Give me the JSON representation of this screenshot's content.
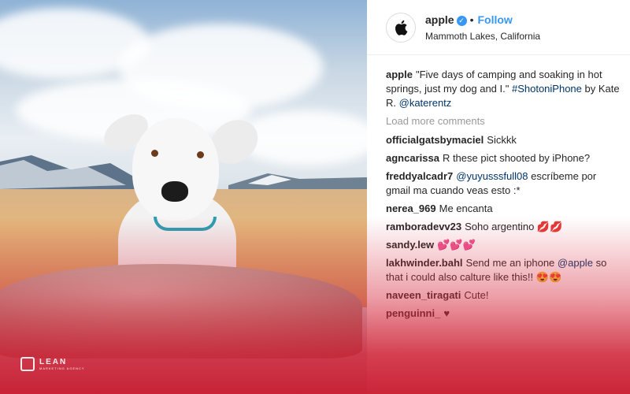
{
  "post": {
    "username": "apple",
    "dot": "•",
    "follow_label": "Follow",
    "location": "Mammoth Lakes, California",
    "caption_user": "apple",
    "caption_text": "\"Five days of camping and soaking in hot springs, just my dog and I.\"",
    "caption_hashtag": "#ShotoniPhone",
    "caption_by": "by Kate R.",
    "caption_mention": "@katerentz",
    "load_more": "Load more comments"
  },
  "comments": [
    {
      "user": "officialgatsbymaciel",
      "text": "Sickkk"
    },
    {
      "user": "agncarissa",
      "text": "R these pict shooted by iPhone?"
    },
    {
      "user": "freddyalcadr7",
      "mention": "@yuyusssfull08",
      "text": "escríbeme por gmail ma cuando veas esto :*"
    },
    {
      "user": "nerea_969",
      "text": "Me encanta"
    },
    {
      "user": "ramboradevv23",
      "text": "Soho argentino 💋💋"
    },
    {
      "user": "sandy.lew",
      "text": "💕💕💕"
    },
    {
      "user": "lakhwinder.bahl",
      "text": "Send me an iphone",
      "mention": "@apple",
      "text2": "so that i could also calture like this!! 😍😍"
    },
    {
      "user": "naveen_tiragati",
      "text": "Cute!"
    },
    {
      "user": "penguinni_",
      "text": "♥"
    }
  ],
  "watermark": {
    "main": "LEAN",
    "sub": "MARKETING AGENCY"
  },
  "colors": {
    "accent": "#3897f0",
    "overlay_red": "#d7283c"
  }
}
